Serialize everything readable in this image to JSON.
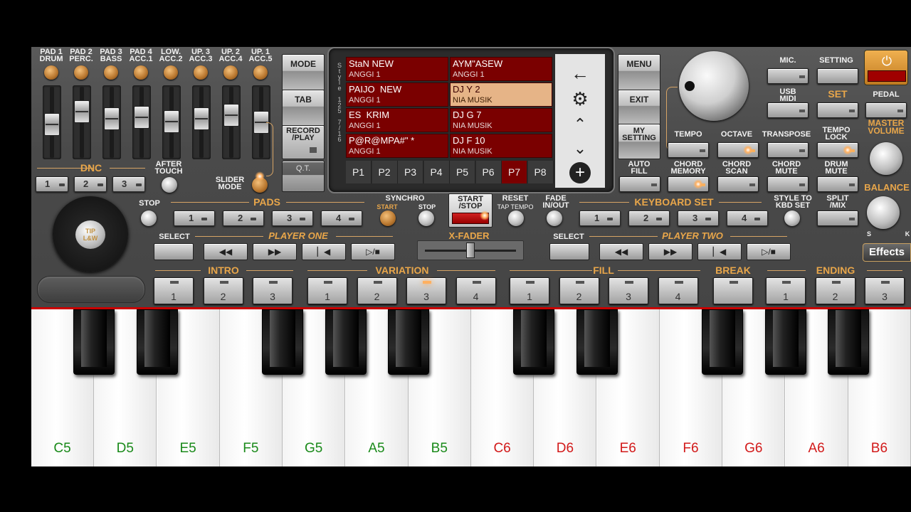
{
  "pads": {
    "labels": [
      "PAD 1\nDRUM",
      "PAD 2\nPERC.",
      "PAD 3\nBASS",
      "PAD 4\nACC.1",
      "LOW.\nACC.2",
      "UP. 3\nACC.3",
      "UP. 2\nACC.4",
      "UP. 1\nACC.5"
    ],
    "dnc_label": "DNC",
    "dnc_buttons": [
      "1",
      "2",
      "3"
    ],
    "after_touch": "AFTER\nTOUCH",
    "slider_mode": "SLIDER\nMODE",
    "fader_levels": [
      0.55,
      0.28,
      0.42,
      0.4,
      0.48,
      0.42,
      0.35,
      0.5
    ]
  },
  "left_buttons": {
    "mode": "MODE",
    "tab": "TAB",
    "record_play": "RECORD\n/PLAY",
    "qt": "Q.T."
  },
  "screen": {
    "side_label": "S\nt\ny\nl\ne\n\n1\n2\n5\n\n7\n/\n1\n6",
    "styles": [
      {
        "name": "StaN NEW",
        "author": "ANGGI 1"
      },
      {
        "name": "AYM\"ASEW",
        "author": "ANGGI 1"
      },
      {
        "name": "PAIJO  NEW",
        "author": "ANGGI 1"
      },
      {
        "name": "DJ Y 2",
        "author": "NIA MUSIK"
      },
      {
        "name": "ES  KRIM",
        "author": "ANGGI 1"
      },
      {
        "name": "DJ G 7",
        "author": "NIA MUSIK"
      },
      {
        "name": "P@R@MPA#\" *",
        "author": "ANGGI 1"
      },
      {
        "name": "DJ F 10",
        "author": "NIA MUSIK"
      }
    ],
    "selected_index": 3,
    "pages": [
      "P1",
      "P2",
      "P3",
      "P4",
      "P5",
      "P6",
      "P7",
      "P8"
    ],
    "active_page": "P7",
    "nav_icons": [
      "back-arrow-icon",
      "gear-icon",
      "chevron-up-icon",
      "chevron-down-icon",
      "plus-icon"
    ]
  },
  "right_menu": {
    "menu": "MENU",
    "exit": "EXIT",
    "my_setting": "MY\nSETTING",
    "auto_fill": "AUTO\nFILL"
  },
  "top_right": {
    "mic": "MIC.",
    "setting": "SETTING",
    "usb_midi": "USB\nMIDI",
    "set": "SET",
    "pedal": "PEDAL",
    "tempo": "TEMPO",
    "octave": "OCTAVE",
    "transpose": "TRANSPOSE",
    "tempo_lock": "TEMPO\nLOCK",
    "master_volume": "MASTER\nVOLUME",
    "chord_memory": "CHORD\nMEMORY",
    "chord_scan": "CHORD\nSCAN",
    "chord_mute": "CHORD\nMUTE",
    "drum_mute": "DRUM\nMUTE",
    "balance": "BALANCE",
    "balance_s": "S",
    "balance_k": "K",
    "power_color": "#e8a040"
  },
  "mid_row": {
    "stop": "STOP",
    "pads_label": "PADS",
    "pad_buttons": [
      "1",
      "2",
      "3",
      "4"
    ],
    "synchro": "SYNCHRO",
    "synchro_start": "START",
    "synchro_stop": "STOP",
    "start_stop": "START\n/STOP",
    "reset": "RESET",
    "tap_tempo": "TAP TEMPO",
    "fade": "FADE\nIN/OUT",
    "keyboard_set": "KEYBOARD SET",
    "kbd_buttons": [
      "1",
      "2",
      "3",
      "4"
    ],
    "style_to_kbd": "STYLE TO\nKBD SET",
    "split_mix": "SPLIT\n/MIX",
    "effects": "Effects",
    "tip_label": "TIP\nL&W"
  },
  "players": {
    "select1": "SELECT",
    "player_one": "PLAYER ONE",
    "xfader": "X-FADER",
    "select2": "SELECT",
    "player_two": "PLAYER TWO",
    "controls": [
      "rewind-icon",
      "fast-forward-icon",
      "skip-start-icon",
      "play-stop-icon"
    ]
  },
  "arranger": {
    "intro": "INTRO",
    "variation": "VARIATION",
    "fill": "FILL",
    "break": "BREAK",
    "ending": "ENDING",
    "intro_buttons": [
      "1",
      "2",
      "3"
    ],
    "variation_buttons": [
      "1",
      "2",
      "3",
      "4"
    ],
    "fill_buttons": [
      "1",
      "2",
      "3",
      "4"
    ],
    "break_buttons": [
      ""
    ],
    "ending_buttons": [
      "1",
      "2",
      "3"
    ],
    "active_variation": 3
  },
  "keyboard": {
    "notes": [
      {
        "label": "C5",
        "color": "#1a8a1a"
      },
      {
        "label": "D5",
        "color": "#1a8a1a"
      },
      {
        "label": "E5",
        "color": "#1a8a1a"
      },
      {
        "label": "F5",
        "color": "#1a8a1a"
      },
      {
        "label": "G5",
        "color": "#1a8a1a"
      },
      {
        "label": "A5",
        "color": "#1a8a1a"
      },
      {
        "label": "B5",
        "color": "#1a8a1a"
      },
      {
        "label": "C6",
        "color": "#d21a1a"
      },
      {
        "label": "D6",
        "color": "#d21a1a"
      },
      {
        "label": "E6",
        "color": "#d21a1a"
      },
      {
        "label": "F6",
        "color": "#d21a1a"
      },
      {
        "label": "G6",
        "color": "#d21a1a"
      },
      {
        "label": "A6",
        "color": "#d21a1a"
      },
      {
        "label": "B6",
        "color": "#d21a1a"
      }
    ]
  }
}
